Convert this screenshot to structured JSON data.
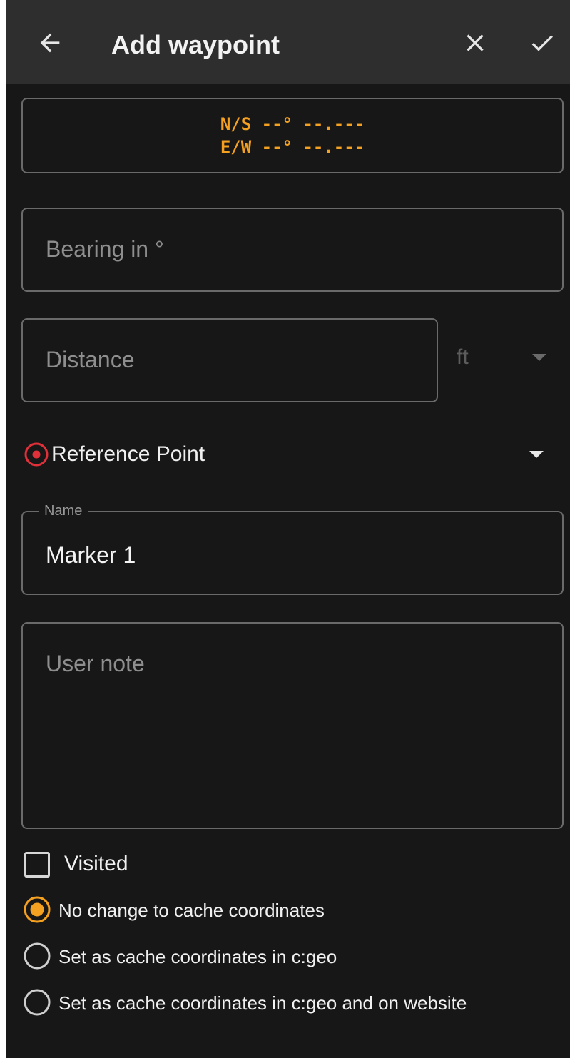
{
  "toolbar": {
    "title": "Add waypoint",
    "back_icon": "arrow-left-icon",
    "close_icon": "close-icon",
    "confirm_icon": "check-icon"
  },
  "coordinates": {
    "lat": "N/S --° --.---",
    "lon": "E/W --° --.---"
  },
  "bearing": {
    "placeholder": "Bearing in °"
  },
  "distance": {
    "placeholder": "Distance",
    "unit": "ft"
  },
  "reference_point": {
    "label": "Reference Point",
    "icon": "target-icon"
  },
  "name": {
    "label": "Name",
    "value": "Marker 1"
  },
  "user_note": {
    "placeholder": "User note"
  },
  "visited": {
    "label": "Visited",
    "checked": false
  },
  "coordinate_options": [
    {
      "label": "No change to cache coordinates",
      "selected": true
    },
    {
      "label": "Set as cache coordinates in c:geo",
      "selected": false
    },
    {
      "label": "Set as cache coordinates in c:geo and on website",
      "selected": false
    }
  ],
  "colors": {
    "accent": "#f4a020",
    "background": "#171717",
    "toolbar": "#2e2e2e",
    "target_red": "#e0303a"
  }
}
